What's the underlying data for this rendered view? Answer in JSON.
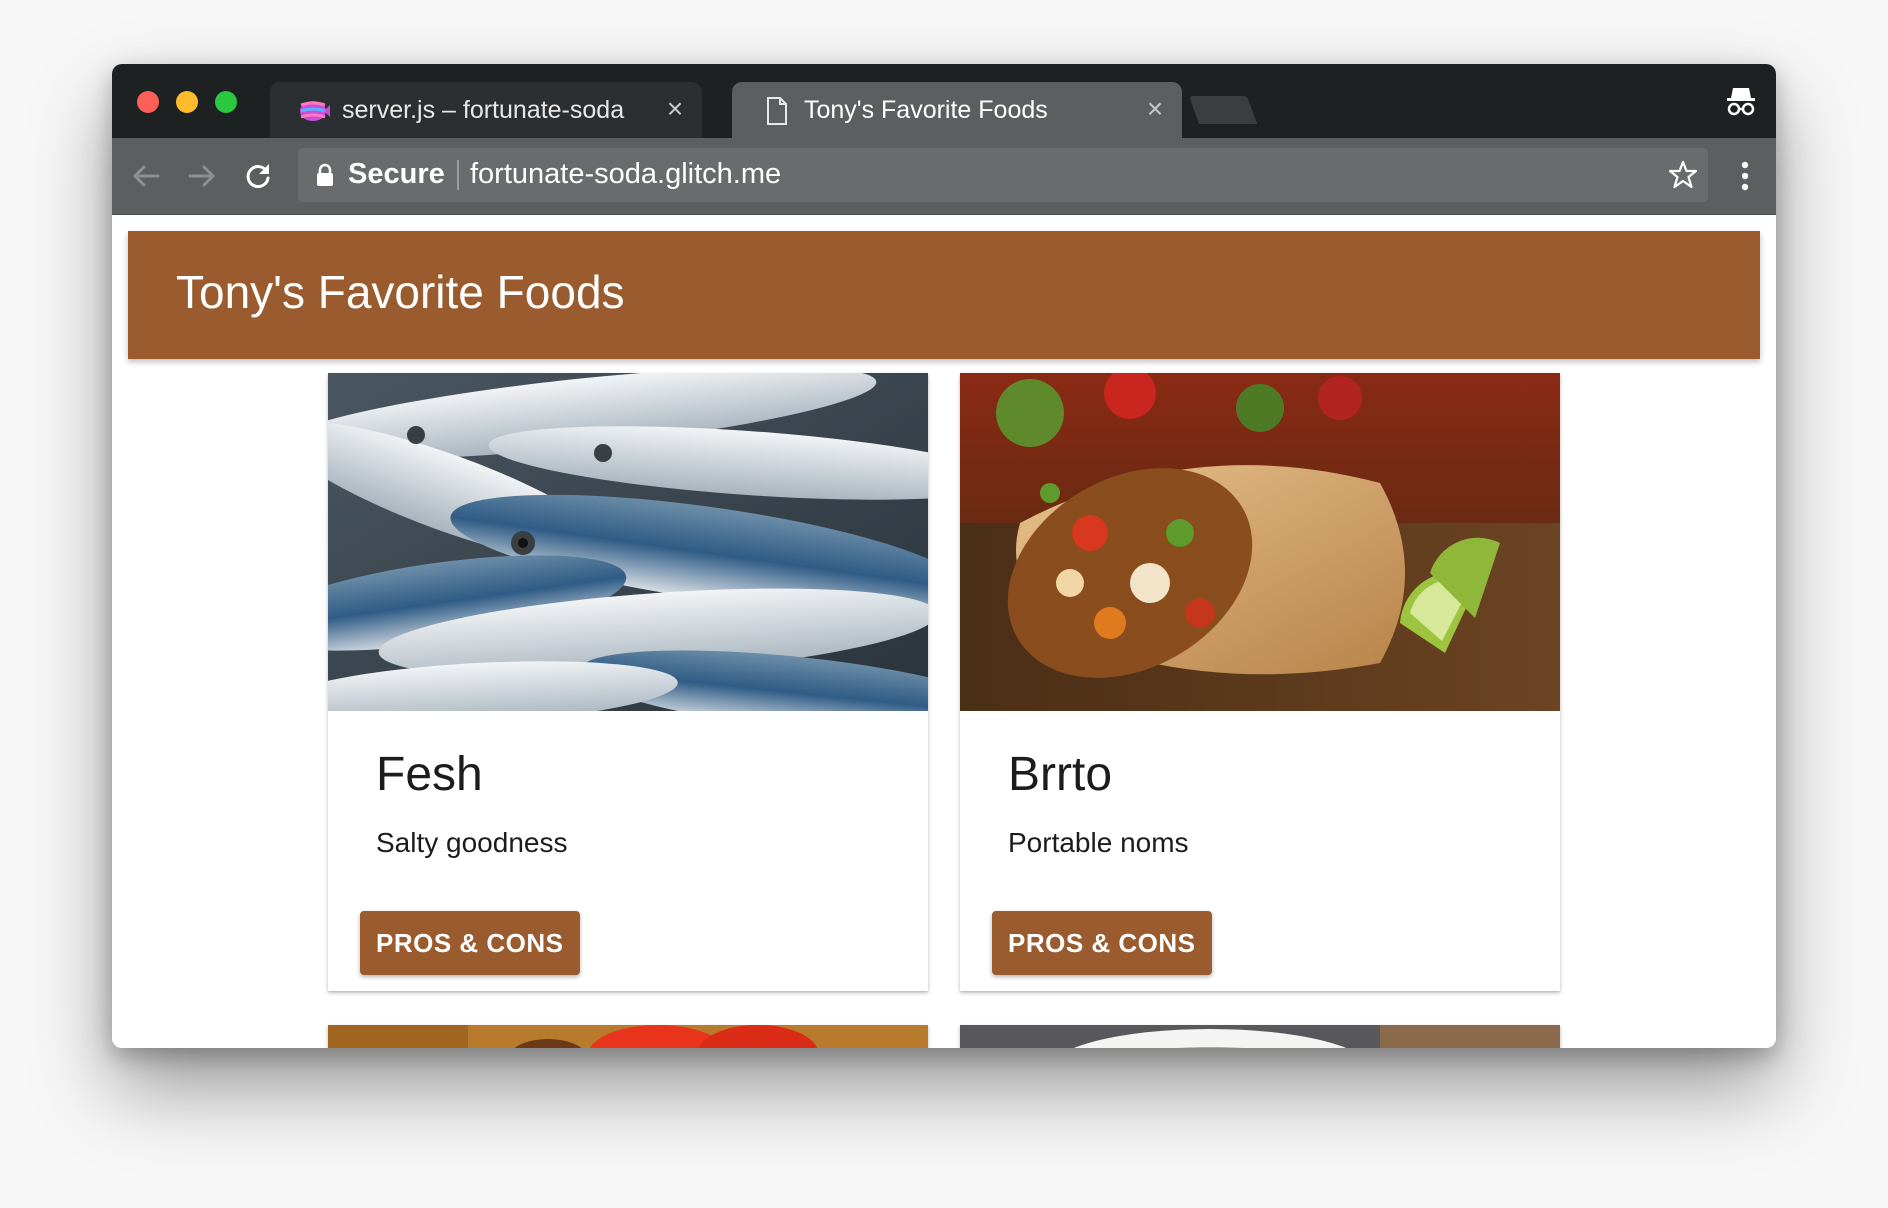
{
  "browser": {
    "tabs": [
      {
        "title": "server.js – fortunate-soda",
        "icon": "glitch-fish-icon",
        "close": "×"
      },
      {
        "title": "Tony's Favorite Foods",
        "icon": "document-icon",
        "close": "×"
      }
    ],
    "address_bar": {
      "security_label": "Secure",
      "url": "fortunate-soda.glitch.me"
    },
    "colors": {
      "tab_strip": "#1e2122",
      "toolbar": "#5d5e60",
      "active_tab": "#5d5e60"
    }
  },
  "page": {
    "app_title": "Tony's Favorite Foods",
    "primary_color": "#9a5b2f",
    "cards": [
      {
        "title": "Fesh",
        "subtitle": "Salty goodness",
        "button": "PROS & CONS",
        "image": "mackerel-fish-photo"
      },
      {
        "title": "Brrto",
        "subtitle": "Portable noms",
        "button": "PROS & CONS",
        "image": "burrito-photo"
      }
    ]
  }
}
